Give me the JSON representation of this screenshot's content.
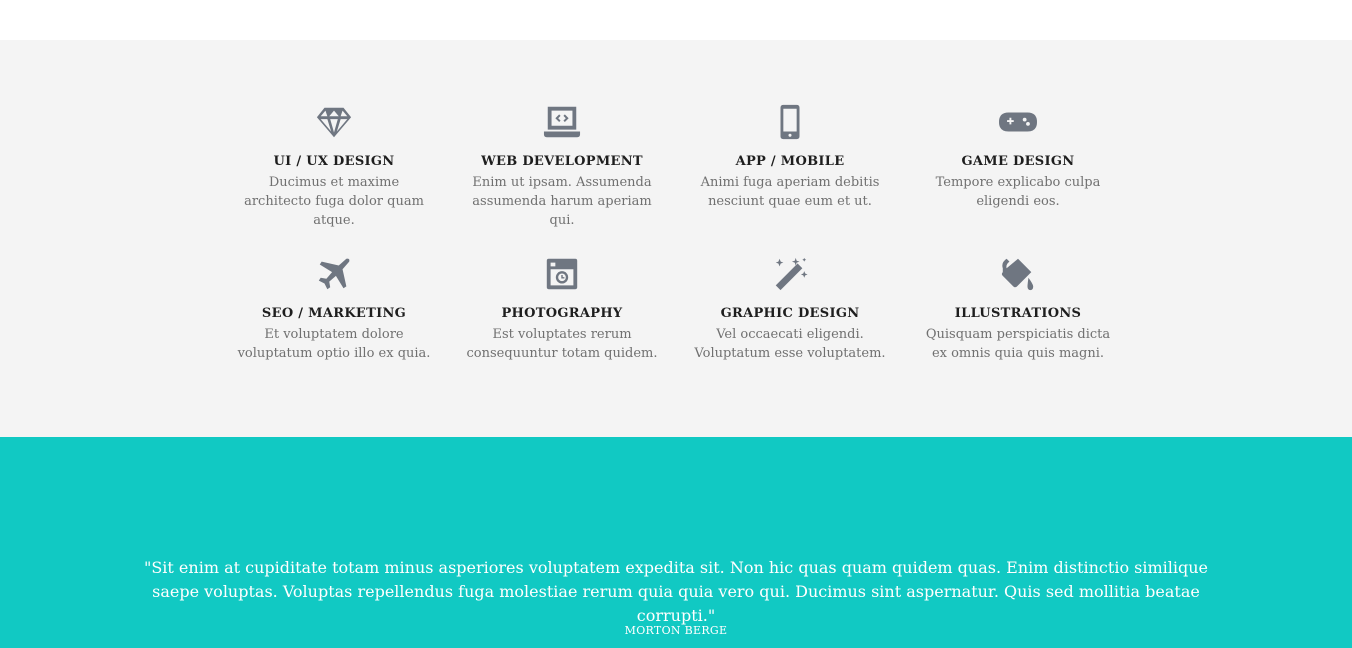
{
  "services": [
    {
      "icon": "diamond-icon",
      "title": "UI / UX DESIGN",
      "desc": "Ducimus et maxime architecto fuga dolor quam atque."
    },
    {
      "icon": "laptop-code-icon",
      "title": "WEB DEVELOPMENT",
      "desc": "Enim ut ipsam. Assumenda assumenda harum aperiam qui."
    },
    {
      "icon": "mobile-phone-icon",
      "title": "APP / MOBILE",
      "desc": "Animi fuga aperiam debitis nesciunt quae eum et ut."
    },
    {
      "icon": "gamepad-icon",
      "title": "GAME DESIGN",
      "desc": "Tempore explicabo culpa eligendi eos."
    },
    {
      "icon": "airplane-icon",
      "title": "SEO / MARKETING",
      "desc": "Et voluptatem dolore voluptatum optio illo ex quia."
    },
    {
      "icon": "camera-icon",
      "title": "PHOTOGRAPHY",
      "desc": "Est voluptates rerum consequuntur totam quidem."
    },
    {
      "icon": "magic-wand-icon",
      "title": "GRAPHIC DESIGN",
      "desc": "Vel occaecati eligendi. Voluptatum esse voluptatem."
    },
    {
      "icon": "paint-bucket-icon",
      "title": "ILLUSTRATIONS",
      "desc": "Quisquam perspiciatis dicta ex omnis quia quis magni."
    }
  ],
  "testimonial": {
    "quote": "\"Sit enim at cupiditate totam minus asperiores voluptatem expedita sit. Non hic quas quam quidem quas. Enim distinctio similique saepe voluptas. Voluptas repellendus fuga molestiae rerum quia quia vero qui. Ducimus sint aspernatur. Quis sed mollitia beatae corrupti.\"",
    "author": "MORTON BERGE"
  },
  "colors": {
    "section_bg": "#f4f4f4",
    "icon": "#6f7681",
    "testimonial_bg": "#11c9c3"
  }
}
